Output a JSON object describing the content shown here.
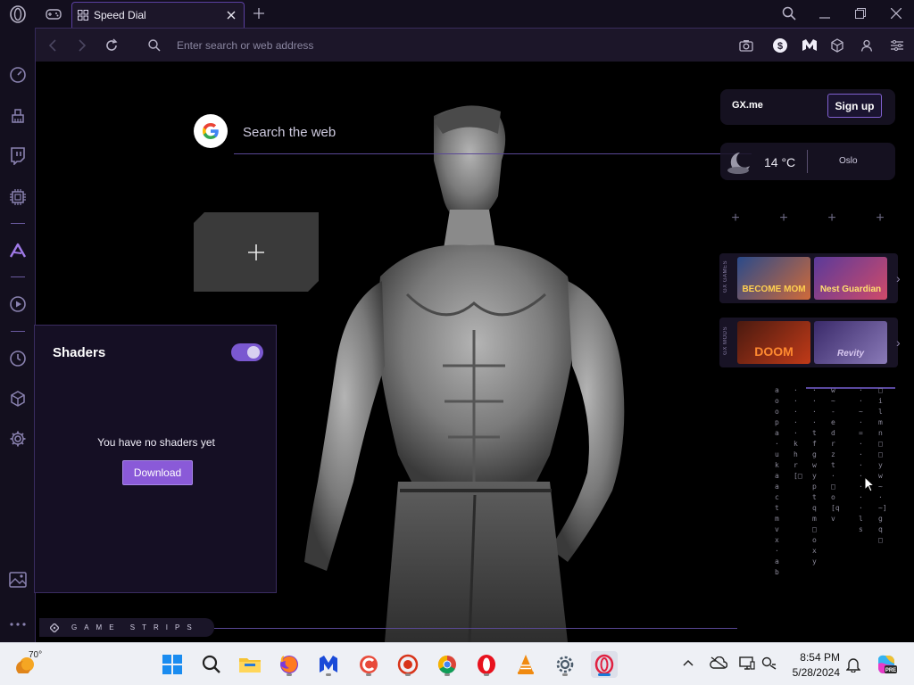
{
  "tab": {
    "title": "Speed Dial"
  },
  "address_bar": {
    "placeholder": "Enter search or web address"
  },
  "search": {
    "placeholder": "Search the web"
  },
  "widgets": {
    "gx_label": "GX.me",
    "signup_label": "Sign up",
    "temperature": "14 °C",
    "city": "Oslo"
  },
  "strips": [
    {
      "label": "GX GAMES",
      "games": [
        "BECOME MOM",
        "Nest Guardian"
      ]
    },
    {
      "label": "GX MODS",
      "games": [
        "DOOM",
        "Revity"
      ]
    }
  ],
  "shaders": {
    "title": "Shaders",
    "empty_text": "You have no shaders yet",
    "download_label": "Download",
    "enabled": true
  },
  "footer": {
    "game_strips_label": "GAME STRIPS"
  },
  "taskbar": {
    "weather_temp": "70°",
    "time": "8:54 PM",
    "date": "5/28/2024"
  },
  "colors": {
    "accent": "#7a58d0",
    "background": "#000000",
    "panel": "#150f24",
    "taskbar": "#eef0f5"
  }
}
